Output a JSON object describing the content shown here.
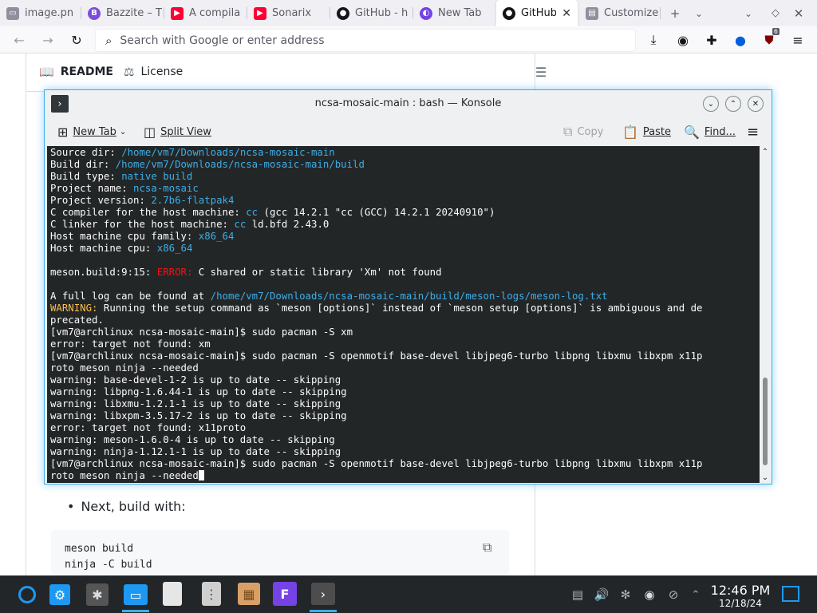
{
  "browser": {
    "tabs": [
      {
        "label": "image.pn",
        "icon": "image-favicon",
        "color": "#5b5b66"
      },
      {
        "label": "Bazzite – T",
        "icon": "bazzite-favicon",
        "color": "#7d4cdb"
      },
      {
        "label": "A compila",
        "icon": "youtube-favicon",
        "color": "#ff0033"
      },
      {
        "label": "Sonarix",
        "icon": "youtube-favicon",
        "color": "#ff0033"
      },
      {
        "label": "GitHub - h",
        "icon": "github-favicon",
        "color": "#15141a"
      },
      {
        "label": "New Tab",
        "icon": "firefox-favicon",
        "color": "#7542e5"
      },
      {
        "label": "GitHub",
        "icon": "github-favicon",
        "color": "#15141a",
        "active": true
      },
      {
        "label": "Customize",
        "icon": "customize-favicon",
        "color": "#5b5b66"
      }
    ],
    "new_tab_glyph": "+",
    "url_placeholder": "Search with Google or enter address",
    "extension_badge": "6"
  },
  "page": {
    "tab_readme": "README",
    "tab_license": "License",
    "bullet_text": "Next, build with:",
    "code_lines": [
      "meson build",
      "ninja -C build"
    ]
  },
  "konsole": {
    "title": "ncsa-mosaic-main : bash — Konsole",
    "new_tab": "New Tab",
    "split_view": "Split View",
    "copy": "Copy",
    "paste": "Paste",
    "find": "Find...",
    "accent": "#3daee9",
    "terminal": {
      "source_dir_label": "Source dir: ",
      "source_dir": "/home/vm7/Downloads/ncsa-mosaic-main",
      "build_dir_label": "Build dir: ",
      "build_dir": "/home/vm7/Downloads/ncsa-mosaic-main/build",
      "build_type_label": "Build type: ",
      "build_type": "native build",
      "project_name_label": "Project name: ",
      "project_name": "ncsa-mosaic",
      "project_version_label": "Project version: ",
      "project_version": "2.7b6-flatpak4",
      "c_compiler_label": "C compiler for the host machine: ",
      "c_compiler_cc": "cc",
      "c_compiler_rest": " (gcc 14.2.1 \"cc (GCC) 14.2.1 20240910\")",
      "c_linker_label": "C linker for the host machine: ",
      "c_linker_cc": "cc",
      "c_linker_rest": " ld.bfd 2.43.0",
      "cpu_family_label": "Host machine cpu family: ",
      "cpu_family": "x86_64",
      "cpu_label": "Host machine cpu: ",
      "cpu": "x86_64",
      "error_prefix": "meson.build:9:15: ",
      "error_word": "ERROR:",
      "error_msg": " C shared or static library 'Xm' not found",
      "log_label": "A full log can be found at ",
      "log_path": "/home/vm7/Downloads/ncsa-mosaic-main/build/meson-logs/meson-log.txt",
      "warning_word": "WARNING:",
      "warning_line1": " Running the setup command as `meson [options]` instead of `meson setup [options]` is ambiguous and de",
      "warning_line2": "precated.",
      "plain_lines": [
        "[vm7@archlinux ncsa-mosaic-main]$ sudo pacman -S xm",
        "error: target not found: xm",
        "[vm7@archlinux ncsa-mosaic-main]$ sudo pacman -S openmotif base-devel libjpeg6-turbo libpng libxmu libxpm x11p",
        "roto meson ninja --needed",
        "warning: base-devel-1-2 is up to date -- skipping",
        "warning: libpng-1.6.44-1 is up to date -- skipping",
        "warning: libxmu-1.2.1-1 is up to date -- skipping",
        "warning: libxpm-3.5.17-2 is up to date -- skipping",
        "error: target not found: x11proto",
        "warning: meson-1.6.0-4 is up to date -- skipping",
        "warning: ninja-1.12.1-1 is up to date -- skipping",
        "[vm7@archlinux ncsa-mosaic-main]$ sudo pacman -S openmotif base-devel libjpeg6-turbo libpng libxmu libxpm x11p"
      ],
      "last_line": "roto meson ninja --needed"
    }
  },
  "taskbar": {
    "time": "12:46 PM",
    "date": "12/18/24"
  }
}
